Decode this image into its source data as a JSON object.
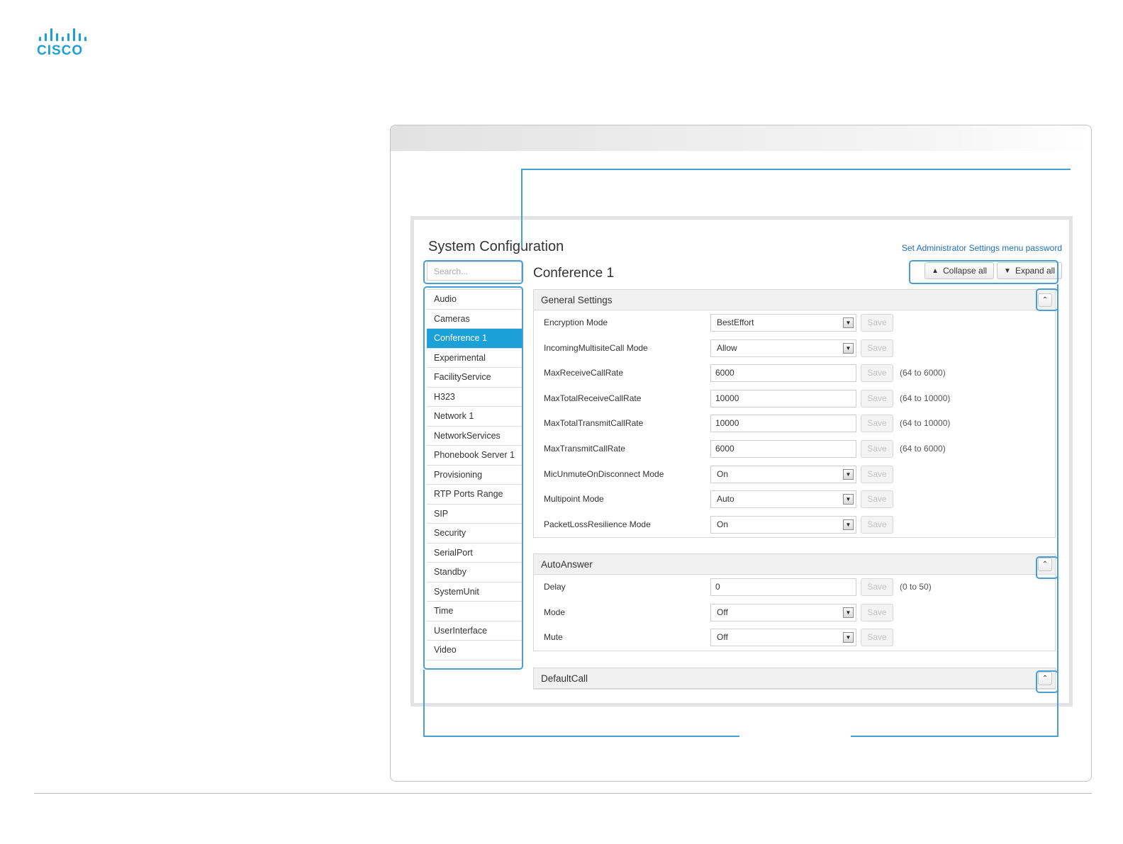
{
  "brand": {
    "logo_text": "CISCO",
    "accent_color": "#1ba0d7"
  },
  "page": {
    "title": "System Configuration",
    "admin_link": "Set Administrator Settings menu password",
    "search_placeholder": "Search...",
    "section_title": "Conference 1",
    "collapse_all": "Collapse all",
    "expand_all": "Expand all",
    "collapse_icon": "chevron-up-icon",
    "expand_icon": "chevron-down-icon"
  },
  "sidebar": {
    "items": [
      {
        "label": "Audio",
        "active": false
      },
      {
        "label": "Cameras",
        "active": false
      },
      {
        "label": "Conference 1",
        "active": true
      },
      {
        "label": "Experimental",
        "active": false
      },
      {
        "label": "FacilityService",
        "active": false
      },
      {
        "label": "H323",
        "active": false
      },
      {
        "label": "Network 1",
        "active": false
      },
      {
        "label": "NetworkServices",
        "active": false
      },
      {
        "label": "Phonebook Server 1",
        "active": false
      },
      {
        "label": "Provisioning",
        "active": false
      },
      {
        "label": "RTP Ports Range",
        "active": false
      },
      {
        "label": "SIP",
        "active": false
      },
      {
        "label": "Security",
        "active": false
      },
      {
        "label": "SerialPort",
        "active": false
      },
      {
        "label": "Standby",
        "active": false
      },
      {
        "label": "SystemUnit",
        "active": false
      },
      {
        "label": "Time",
        "active": false
      },
      {
        "label": "UserInterface",
        "active": false
      },
      {
        "label": "Video",
        "active": false
      }
    ]
  },
  "save_label": "Save",
  "panels": [
    {
      "title": "General Settings",
      "rows": [
        {
          "label": "Encryption Mode",
          "type": "select",
          "value": "BestEffort",
          "hint": ""
        },
        {
          "label": "IncomingMultisiteCall Mode",
          "type": "select",
          "value": "Allow",
          "hint": ""
        },
        {
          "label": "MaxReceiveCallRate",
          "type": "input",
          "value": "6000",
          "hint": "(64 to 6000)"
        },
        {
          "label": "MaxTotalReceiveCallRate",
          "type": "input",
          "value": "10000",
          "hint": "(64 to 10000)"
        },
        {
          "label": "MaxTotalTransmitCallRate",
          "type": "input",
          "value": "10000",
          "hint": "(64 to 10000)"
        },
        {
          "label": "MaxTransmitCallRate",
          "type": "input",
          "value": "6000",
          "hint": "(64 to 6000)"
        },
        {
          "label": "MicUnmuteOnDisconnect Mode",
          "type": "select",
          "value": "On",
          "hint": ""
        },
        {
          "label": "Multipoint Mode",
          "type": "select",
          "value": "Auto",
          "hint": ""
        },
        {
          "label": "PacketLossResilience Mode",
          "type": "select",
          "value": "On",
          "hint": ""
        }
      ]
    },
    {
      "title": "AutoAnswer",
      "rows": [
        {
          "label": "Delay",
          "type": "input",
          "value": "0",
          "hint": "(0 to 50)"
        },
        {
          "label": "Mode",
          "type": "select",
          "value": "Off",
          "hint": ""
        },
        {
          "label": "Mute",
          "type": "select",
          "value": "Off",
          "hint": ""
        }
      ]
    },
    {
      "title": "DefaultCall",
      "rows": []
    }
  ]
}
